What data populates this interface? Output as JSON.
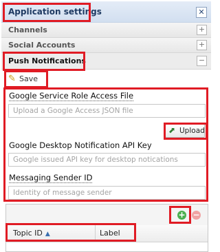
{
  "header": {
    "title": "Application settings",
    "close_glyph": "✕"
  },
  "sections": {
    "channels": {
      "label": "Channels",
      "toggle": "+"
    },
    "social": {
      "label": "Social Accounts",
      "toggle": "+"
    },
    "push": {
      "label": "Push Notifications",
      "toggle": "−"
    }
  },
  "toolbar": {
    "save_label": "Save",
    "save_icon": "pencil-icon"
  },
  "fields": {
    "google_role": {
      "label": "Google Service Role Access File",
      "placeholder": "Upload a Google Access JSON file"
    },
    "upload_label": "Upload",
    "desktop_key": {
      "label": "Google Desktop Notification API Key",
      "placeholder": "Google issued API key for desktop notications"
    },
    "sender_id": {
      "label": "Messaging Sender ID",
      "placeholder": "Identity of message sender"
    }
  },
  "grid": {
    "add_glyph": "+",
    "delete_glyph": "−",
    "columns": {
      "topic": "Topic ID",
      "label": "Label"
    },
    "sort_arrow": "▲"
  },
  "colors": {
    "highlight": "#e01b24",
    "header_text": "#1f3b63",
    "add": "#4caf50",
    "delete_disabled": "#f0a3a3"
  }
}
